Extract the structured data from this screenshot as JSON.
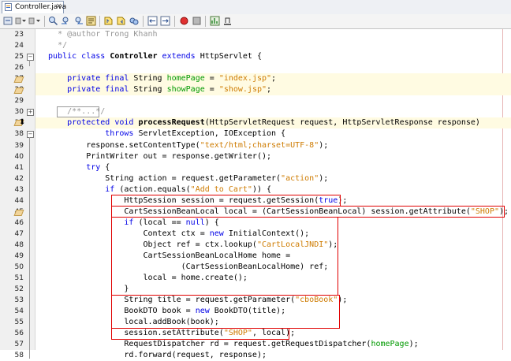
{
  "tab": {
    "title": "Controller.java",
    "close": "×"
  },
  "toolbar": {
    "icons": [
      "back-icon",
      "history-icon",
      "find-selection-icon",
      "find-prev-icon",
      "find-next-icon",
      "toggle-highlight-icon",
      "prev-bookmark-icon",
      "next-bookmark-icon",
      "toggle-bookmark-icon",
      "shift-left-icon",
      "shift-right-icon",
      "start-macro-icon",
      "stop-macro-icon",
      "chart-icon",
      "underline-icon"
    ]
  },
  "code_lines": [
    {
      "num": "23",
      "parts": [
        [
          "cmt",
          "    * @author Trong Khanh"
        ]
      ]
    },
    {
      "num": "24",
      "parts": [
        [
          "cmt",
          "    */"
        ]
      ]
    },
    {
      "num": "25",
      "parts": [
        [
          "kw",
          "  public class "
        ],
        [
          "bold",
          "Controller"
        ],
        [
          "kw",
          " extends "
        ],
        [
          "txt",
          "HttpServlet {"
        ]
      ]
    },
    {
      "num": "26",
      "parts": []
    },
    {
      "num": "27",
      "parts": [
        [
          "kw",
          "      private final "
        ],
        [
          "txt",
          "String "
        ],
        [
          "fld",
          "homePage"
        ],
        [
          "txt",
          " = "
        ],
        [
          "str",
          "\"index.jsp\""
        ],
        [
          "txt",
          ";"
        ]
      ]
    },
    {
      "num": "28",
      "parts": [
        [
          "kw",
          "      private final "
        ],
        [
          "txt",
          "String "
        ],
        [
          "fld",
          "showPage"
        ],
        [
          "txt",
          " = "
        ],
        [
          "str",
          "\"show.jsp\""
        ],
        [
          "txt",
          ";"
        ]
      ]
    },
    {
      "num": "29",
      "parts": []
    },
    {
      "num": "30",
      "parts": [
        [
          "cmt",
          "      /**...*/"
        ]
      ]
    },
    {
      "num": "37",
      "parts": [
        [
          "kw",
          "      protected void "
        ],
        [
          "bold",
          "processRequest"
        ],
        [
          "txt",
          "(HttpServletRequest request, HttpServletResponse response)"
        ]
      ]
    },
    {
      "num": "38",
      "parts": [
        [
          "kw",
          "              throws "
        ],
        [
          "txt",
          "ServletException, IOException {"
        ]
      ]
    },
    {
      "num": "39",
      "parts": [
        [
          "txt",
          "          response.setContentType("
        ],
        [
          "str",
          "\"text/html;charset=UTF-8\""
        ],
        [
          "txt",
          ");"
        ]
      ]
    },
    {
      "num": "40",
      "parts": [
        [
          "txt",
          "          PrintWriter out = response.getWriter();"
        ]
      ]
    },
    {
      "num": "41",
      "parts": [
        [
          "kw",
          "          try "
        ],
        [
          "txt",
          "{"
        ]
      ]
    },
    {
      "num": "42",
      "parts": [
        [
          "txt",
          "              String action = request.getParameter("
        ],
        [
          "str",
          "\"action\""
        ],
        [
          "txt",
          ");"
        ]
      ]
    },
    {
      "num": "43",
      "parts": [
        [
          "kw",
          "              if "
        ],
        [
          "txt",
          "(action.equals("
        ],
        [
          "str",
          "\"Add to Cart\""
        ],
        [
          "txt",
          ")) {"
        ]
      ]
    },
    {
      "num": "44",
      "parts": [
        [
          "txt",
          "                  HttpSession session = request.getSession("
        ],
        [
          "kw",
          "true"
        ],
        [
          "txt",
          ");"
        ]
      ]
    },
    {
      "num": "45",
      "parts": [
        [
          "txt",
          "                  CartSessionBeanLocal local = (CartSessionBeanLocal) session.getAttribute("
        ],
        [
          "str",
          "\"SHOP\""
        ],
        [
          "txt",
          ");"
        ]
      ]
    },
    {
      "num": "46",
      "parts": [
        [
          "kw",
          "                  if "
        ],
        [
          "txt",
          "(local == "
        ],
        [
          "kw",
          "null"
        ],
        [
          "txt",
          ") {"
        ]
      ]
    },
    {
      "num": "47",
      "parts": [
        [
          "txt",
          "                      Context ctx = "
        ],
        [
          "kw",
          "new "
        ],
        [
          "txt",
          "InitialContext();"
        ]
      ]
    },
    {
      "num": "48",
      "parts": [
        [
          "txt",
          "                      Object ref = ctx.lookup("
        ],
        [
          "str",
          "\"CartLocalJNDI\""
        ],
        [
          "txt",
          ");"
        ]
      ]
    },
    {
      "num": "49",
      "parts": [
        [
          "txt",
          "                      CartSessionBeanLocalHome home ="
        ]
      ]
    },
    {
      "num": "50",
      "parts": [
        [
          "txt",
          "                              (CartSessionBeanLocalHome) ref;"
        ]
      ]
    },
    {
      "num": "51",
      "parts": [
        [
          "txt",
          "                      local = home.create();"
        ]
      ]
    },
    {
      "num": "52",
      "parts": [
        [
          "txt",
          "                  }"
        ]
      ]
    },
    {
      "num": "53",
      "parts": [
        [
          "txt",
          "                  String title = request.getParameter("
        ],
        [
          "str",
          "\"cboBook\""
        ],
        [
          "txt",
          ");"
        ]
      ]
    },
    {
      "num": "54",
      "parts": [
        [
          "txt",
          "                  BookDTO book = "
        ],
        [
          "kw",
          "new "
        ],
        [
          "txt",
          "BookDTO(title);"
        ]
      ]
    },
    {
      "num": "55",
      "parts": [
        [
          "txt",
          "                  local.addBook(book);"
        ]
      ]
    },
    {
      "num": "56",
      "parts": [
        [
          "txt",
          "                  session.setAttribute("
        ],
        [
          "str",
          "\"SHOP\""
        ],
        [
          "txt",
          ", local);"
        ]
      ]
    },
    {
      "num": "57",
      "parts": [
        [
          "txt",
          "                  RequestDispatcher rd = request.getRequestDispatcher("
        ],
        [
          "fld",
          "homePage"
        ],
        [
          "txt",
          ");"
        ]
      ]
    },
    {
      "num": "58",
      "parts": [
        [
          "txt",
          "                  rd.forward(request, response);"
        ]
      ]
    }
  ],
  "colors": {
    "keyword": "#0000e6",
    "string": "#ce7b00",
    "field": "#009900",
    "comment": "#969696",
    "highlight_box": "#e00000"
  }
}
